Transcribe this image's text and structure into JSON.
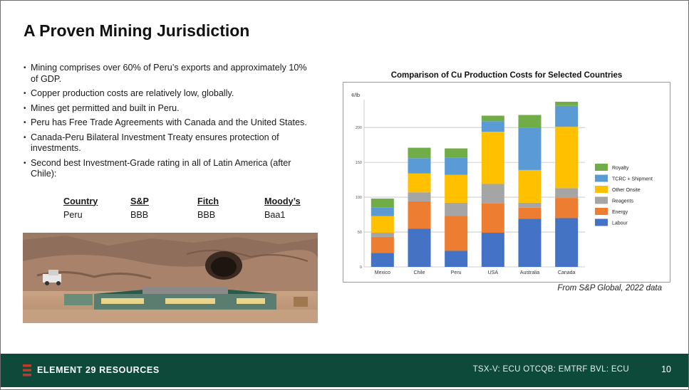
{
  "title": "A Proven Mining Jurisdiction",
  "bullets": [
    "Mining comprises over 60% of Peru’s exports and approximately 10% of GDP.",
    "Copper production costs are relatively low, globally.",
    "Mines get permitted and built in Peru.",
    "Peru has Free Trade Agreements with Canada and the United States.",
    "Canada-Peru Bilateral Investment Treaty ensures protection of investments.",
    "Second best Investment-Grade rating in all of Latin America (after Chile):"
  ],
  "ratings": {
    "headers": [
      "Country",
      "S&P",
      "Fitch",
      "Moody’s"
    ],
    "row": [
      "Peru",
      "BBB",
      "BBB",
      "Baa1"
    ]
  },
  "caption": "From S&P Global, 2022 data",
  "footer": {
    "company": "ELEMENT 29 RESOURCES",
    "tickers": "TSX-V: ECU  OTCQB: EMTRF  BVL: ECU",
    "page": "10"
  },
  "colors": {
    "footer_bg": "#0d4a3a",
    "logo_accent": "#c0392b"
  },
  "chart_data": {
    "type": "bar",
    "stacked": true,
    "title": "Comparison of Cu Production Costs for Selected Countries",
    "ylabel": "¢/lb",
    "xlabel": "",
    "ylim": [
      0,
      240
    ],
    "yticks": [
      0,
      50,
      100,
      150,
      200
    ],
    "grid": true,
    "legend_position": "right",
    "categories": [
      "Mexico",
      "Chile",
      "Peru",
      "USA",
      "Australia",
      "Canada"
    ],
    "series": [
      {
        "name": "Labour",
        "color": "#4472c4",
        "values": [
          20,
          55,
          23,
          49,
          69,
          70
        ]
      },
      {
        "name": "Energy",
        "color": "#ed7d31",
        "values": [
          23,
          39,
          50,
          42,
          16,
          29
        ]
      },
      {
        "name": "Reagents",
        "color": "#a5a5a5",
        "values": [
          6,
          13,
          19,
          28,
          7,
          14
        ]
      },
      {
        "name": "Other Onsite",
        "color": "#ffc000",
        "values": [
          24,
          27,
          40,
          75,
          47,
          88
        ]
      },
      {
        "name": "TCRC + Shipment",
        "color": "#5b9bd5",
        "values": [
          12,
          22,
          25,
          15,
          61,
          30
        ]
      },
      {
        "name": "Royalty",
        "color": "#70ad47",
        "values": [
          13,
          15,
          13,
          8,
          18,
          6
        ]
      }
    ]
  }
}
